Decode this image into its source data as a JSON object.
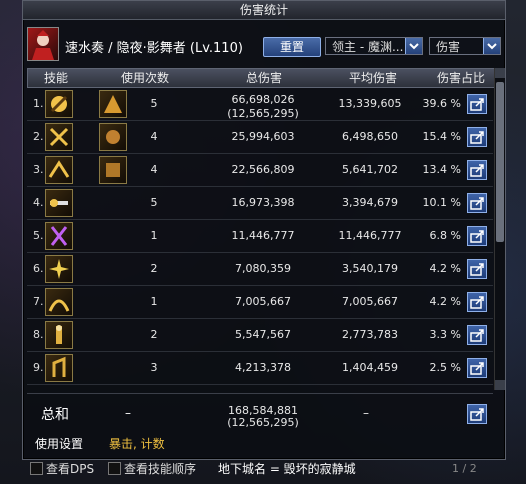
{
  "window": {
    "title": "伤害统计"
  },
  "header": {
    "character": "速水奏 / 隐夜·影舞者 (Lv.110)",
    "reset_label": "重置",
    "target_select": "领主 - 魔渊...",
    "metric_select": "伤害"
  },
  "columns": {
    "skill": "技能",
    "uses": "使用次数",
    "total": "总伤害",
    "avg": "平均伤害",
    "share": "伤害占比"
  },
  "rows": [
    {
      "idx": "1.",
      "uses": "5",
      "total": "66,698,026",
      "total2": "(12,565,295)",
      "avg": "13,339,605",
      "share": "39.6 %"
    },
    {
      "idx": "2.",
      "uses": "4",
      "total": "25,994,603",
      "total2": "",
      "avg": "6,498,650",
      "share": "15.4 %"
    },
    {
      "idx": "3.",
      "uses": "4",
      "total": "22,566,809",
      "total2": "",
      "avg": "5,641,702",
      "share": "13.4 %"
    },
    {
      "idx": "4.",
      "uses": "5",
      "total": "16,973,398",
      "total2": "",
      "avg": "3,394,679",
      "share": "10.1 %"
    },
    {
      "idx": "5.",
      "uses": "1",
      "total": "11,446,777",
      "total2": "",
      "avg": "11,446,777",
      "share": "6.8 %"
    },
    {
      "idx": "6.",
      "uses": "2",
      "total": "7,080,359",
      "total2": "",
      "avg": "3,540,179",
      "share": "4.2 %"
    },
    {
      "idx": "7.",
      "uses": "1",
      "total": "7,005,667",
      "total2": "",
      "avg": "7,005,667",
      "share": "4.2 %"
    },
    {
      "idx": "8.",
      "uses": "2",
      "total": "5,547,567",
      "total2": "",
      "avg": "2,773,783",
      "share": "3.3 %"
    },
    {
      "idx": "9.",
      "uses": "3",
      "total": "4,213,378",
      "total2": "",
      "avg": "1,404,459",
      "share": "2.5 %"
    }
  ],
  "summary": {
    "label": "总和",
    "uses": "–",
    "total": "168,584,881",
    "total2": "(12,565,295)",
    "avg": "–"
  },
  "tabs": {
    "settings": "使用设置",
    "crit": "暴击, 计数"
  },
  "footer": {
    "view_dps": "查看DPS",
    "view_skill_order": "查看技能顺序",
    "dungeon": "地下城名 = 毁坏的寂静城",
    "page": "1 / 2"
  },
  "colors": {
    "accent": "#2f5aa0",
    "tab_highlight": "#f0c040"
  }
}
